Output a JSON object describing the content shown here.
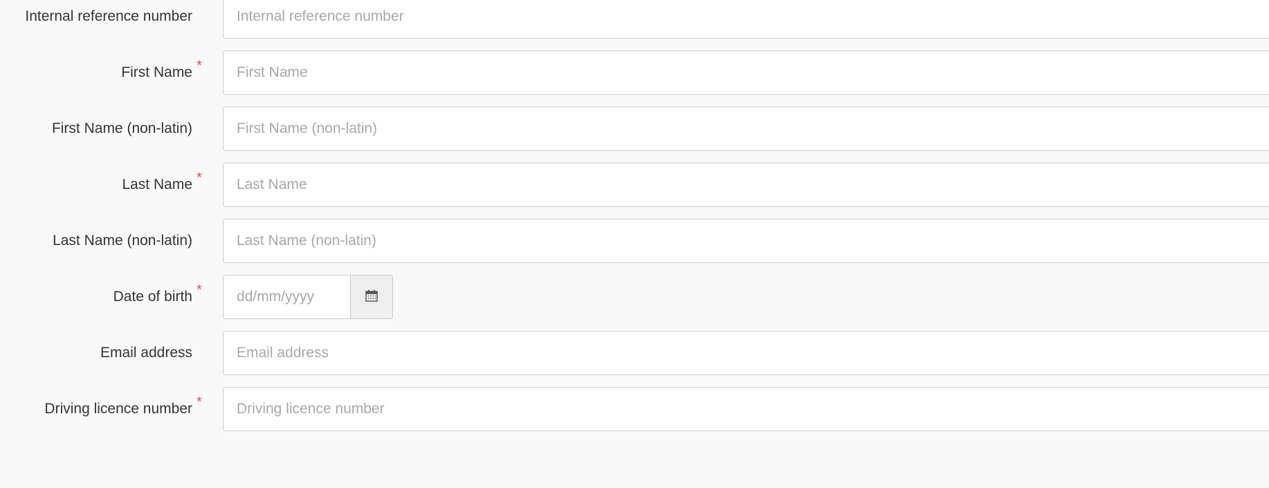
{
  "form": {
    "fields": [
      {
        "key": "internal_reference",
        "label": "Internal reference number",
        "placeholder": "Internal reference number",
        "value": "",
        "required": false
      },
      {
        "key": "first_name",
        "label": "First Name",
        "placeholder": "First Name",
        "value": "",
        "required": true
      },
      {
        "key": "first_name_nonlatin",
        "label": "First Name (non-latin)",
        "placeholder": "First Name (non-latin)",
        "value": "",
        "required": false
      },
      {
        "key": "last_name",
        "label": "Last Name",
        "placeholder": "Last Name",
        "value": "",
        "required": true
      },
      {
        "key": "last_name_nonlatin",
        "label": "Last Name (non-latin)",
        "placeholder": "Last Name (non-latin)",
        "value": "",
        "required": false
      },
      {
        "key": "date_of_birth",
        "label": "Date of birth",
        "placeholder": "dd/mm/yyyy",
        "value": "",
        "required": true,
        "addon_icon": "calendar-icon"
      },
      {
        "key": "email",
        "label": "Email address",
        "placeholder": "Email address",
        "value": "",
        "required": false
      },
      {
        "key": "driving_licence",
        "label": "Driving licence number",
        "placeholder": "Driving licence number",
        "value": "",
        "required": true
      }
    ],
    "required_marker": "*"
  },
  "colors": {
    "background": "#f9f9f9",
    "label_text": "#333333",
    "placeholder_text": "#a8a8a8",
    "required_marker": "#d9534f",
    "input_border": "#cccccc",
    "addon_background": "#eeeeee"
  }
}
